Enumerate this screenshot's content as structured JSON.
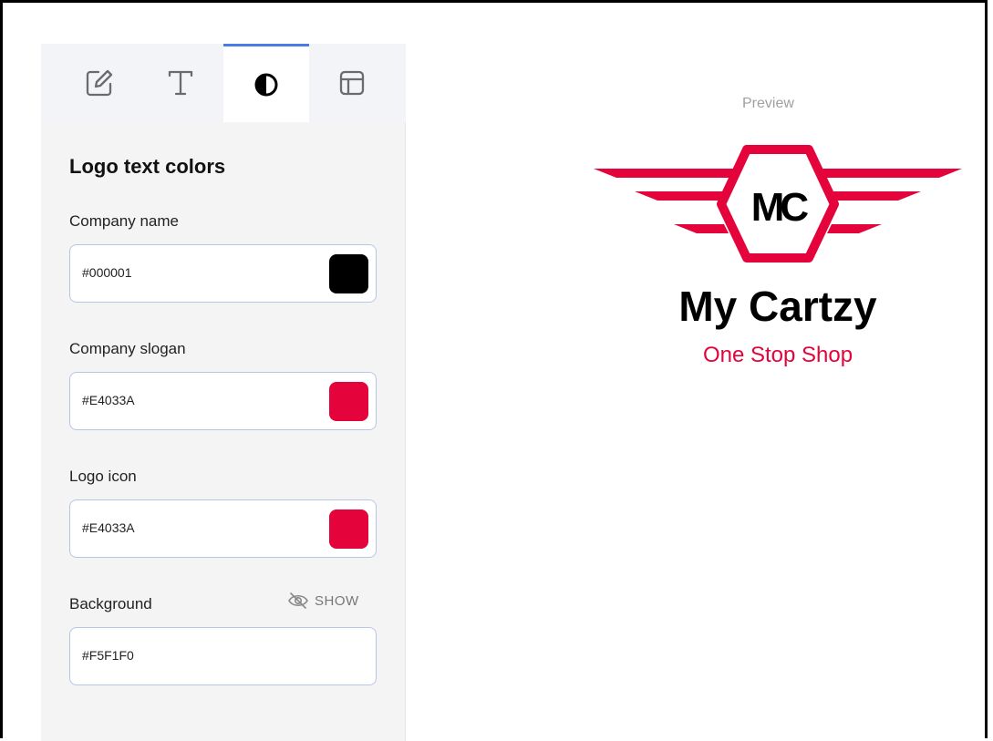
{
  "tabs": [
    {
      "icon": "edit-icon",
      "active": false
    },
    {
      "icon": "text-icon",
      "active": false
    },
    {
      "icon": "contrast-icon",
      "active": true
    },
    {
      "icon": "layout-icon",
      "active": false
    }
  ],
  "section_title": "Logo text colors",
  "fields": {
    "company_name": {
      "label": "Company name",
      "value": "#000001",
      "swatch": "#000001"
    },
    "company_slogan": {
      "label": "Company slogan",
      "value": "#E4033A",
      "swatch": "#E4033A"
    },
    "logo_icon": {
      "label": "Logo icon",
      "value": "#E4033A",
      "swatch": "#E4033A"
    },
    "background": {
      "label": "Background",
      "value": "#F5F1F0",
      "toggle_label": "SHOW",
      "toggle_icon": "eye-off-icon"
    }
  },
  "preview": {
    "label": "Preview",
    "monogram": "MC",
    "company_name": "My Cartzy",
    "slogan": "One Stop Shop"
  },
  "colors": {
    "accent": "#4a7ce8",
    "logo": "#E4033A",
    "text": "#000001"
  }
}
